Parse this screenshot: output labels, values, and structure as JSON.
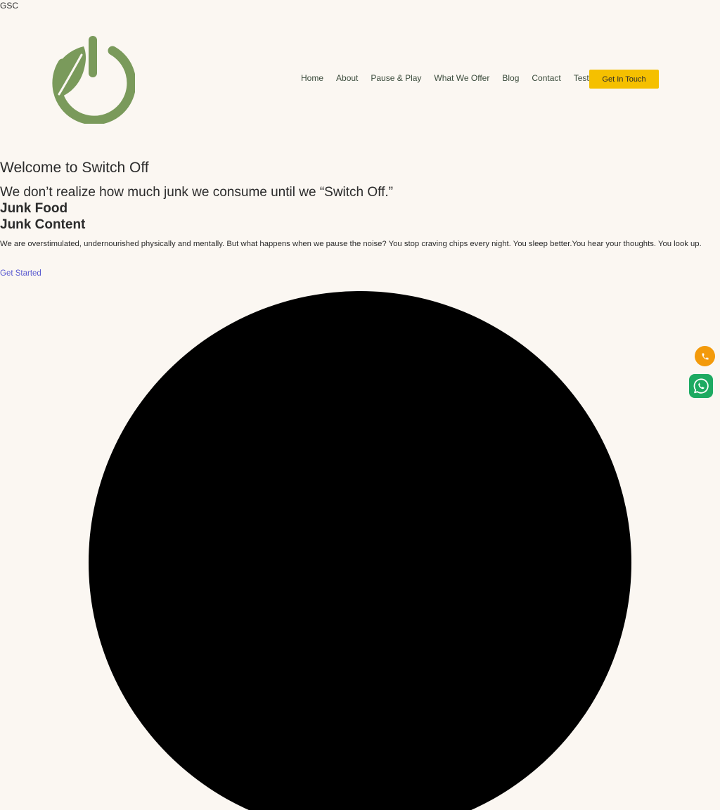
{
  "site": {
    "tag": "GSC"
  },
  "header": {
    "logo_icon": "power-leaf-icon",
    "nav": {
      "items": [
        {
          "label": "Home"
        },
        {
          "label": "About"
        },
        {
          "label": "Pause & Play"
        },
        {
          "label": "What We Offer"
        },
        {
          "label": "Blog"
        },
        {
          "label": "Contact"
        },
        {
          "label": "Test"
        }
      ]
    },
    "cta_label": "Get In Touch"
  },
  "hero": {
    "title": "Welcome to Switch Off",
    "subtitle": "We don’t realize how much junk we consume until we “Switch Off.”",
    "junk_food": "Junk Food",
    "junk_content": "Junk Content",
    "description": "We are overstimulated, undernourished physically and mentally. But what happens when we pause the noise? You stop craving chips every night. You sleep better.You hear your thoughts. You look up.",
    "get_started": "Get Started"
  },
  "floating": {
    "phone_icon": "phone-icon",
    "whatsapp_icon": "whatsapp-icon"
  },
  "colors": {
    "background": "#FBF7F2",
    "logo_green": "#7A9A5B",
    "cta_yellow": "#F5C000",
    "phone_orange": "#F39A0B",
    "whatsapp_green": "#1DAA61",
    "link_blue": "#5A5AD0",
    "text_dark": "#2B2B2B",
    "hero_shape": "#000000"
  }
}
